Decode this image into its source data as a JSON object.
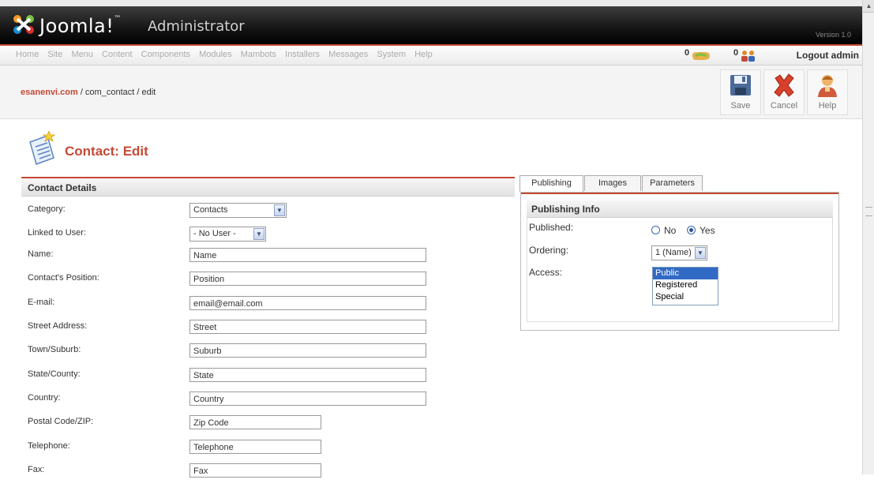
{
  "header": {
    "logo_text": "Joomla!",
    "logo_tm": "™",
    "admin_label": "Administrator",
    "version": "Version 1.0"
  },
  "menu": {
    "items": [
      "Home",
      "Site",
      "Menu",
      "Content",
      "Components",
      "Modules",
      "Mambots",
      "Installers",
      "Messages",
      "System",
      "Help"
    ]
  },
  "status": {
    "messages_count": "0",
    "users_count": "0",
    "logout_label": "Logout admin"
  },
  "breadcrumb": {
    "site": "esanenvi.com",
    "path": " / com_contact / edit"
  },
  "toolbar": {
    "save_label": "Save",
    "cancel_label": "Cancel",
    "help_label": "Help"
  },
  "page": {
    "title": "Contact:",
    "subtitle": "Edit"
  },
  "details": {
    "heading": "Contact Details",
    "category": {
      "label": "Category:",
      "value": "Contacts"
    },
    "user": {
      "label": "Linked to User:",
      "value": "- No User -"
    },
    "name": {
      "label": "Name:",
      "value": "Name"
    },
    "position": {
      "label": "Contact's Position:",
      "value": "Position"
    },
    "email": {
      "label": "E-mail:",
      "value": "email@email.com"
    },
    "street": {
      "label": "Street Address:",
      "value": "Street"
    },
    "suburb": {
      "label": "Town/Suburb:",
      "value": "Suburb"
    },
    "state": {
      "label": "State/County:",
      "value": "State"
    },
    "country": {
      "label": "Country:",
      "value": "Country"
    },
    "zip": {
      "label": "Postal Code/ZIP:",
      "value": "Zip Code"
    },
    "telephone": {
      "label": "Telephone:",
      "value": "Telephone"
    },
    "fax": {
      "label": "Fax:",
      "value": "Fax"
    }
  },
  "tabs": [
    "Publishing",
    "Images",
    "Parameters"
  ],
  "publishing": {
    "heading": "Publishing Info",
    "published_label": "Published:",
    "no_label": "No",
    "yes_label": "Yes",
    "ordering_label": "Ordering:",
    "ordering_value": "1 (Name)",
    "access_label": "Access:",
    "access_options": [
      "Public",
      "Registered",
      "Special"
    ],
    "access_selected": "Public"
  },
  "colors": {
    "accent": "#c64934",
    "header_bg": "#000000",
    "list_selected": "#316ac5"
  }
}
